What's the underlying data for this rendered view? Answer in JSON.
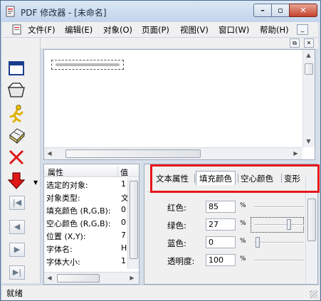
{
  "window": {
    "title": "PDF 修改器 - [未命名]",
    "minimize_label": "–",
    "maximize_label": "▫",
    "close_label": "✕"
  },
  "menu": {
    "items": [
      "文件(F)",
      "编辑(E)",
      "对象(O)",
      "页面(P)",
      "视图(V)",
      "窗口(W)",
      "帮助(H)"
    ],
    "mdi_minimize": "_",
    "mdi_restore": "⧉",
    "mdi_close": "✕"
  },
  "toolbar_icons": [
    "window-icon",
    "open-folder-icon",
    "run-icon",
    "printer-icon",
    "delete-x-icon",
    "down-arrow-icon"
  ],
  "nav_buttons": {
    "first": "|◀",
    "prev": "◀",
    "next": "▶",
    "last": "▶|"
  },
  "properties": {
    "header_name": "属性",
    "header_value": "值",
    "rows": [
      {
        "name": "选定的对象:",
        "value": "1"
      },
      {
        "name": "对象类型:",
        "value": "文"
      },
      {
        "name": "填充颜色 (R,G,B):",
        "value": "0"
      },
      {
        "name": "空心颜色 (R,G,B):",
        "value": "0"
      },
      {
        "name": "位置 (X,Y):",
        "value": "7"
      },
      {
        "name": "字体名:",
        "value": "H"
      },
      {
        "name": "字体大小:",
        "value": "1"
      }
    ]
  },
  "tabs": {
    "items": [
      "文本属性",
      "填充颜色",
      "空心颜色",
      "变形"
    ],
    "active_index": 1
  },
  "fill_color": {
    "red_label": "红色:",
    "red_value": "85",
    "green_label": "绿色:",
    "green_value": "27",
    "blue_label": "蓝色:",
    "blue_value": "0",
    "opacity_label": "透明度:",
    "opacity_value": "100",
    "percent": "%"
  },
  "status": {
    "text": "就绪"
  },
  "colors": {
    "highlight": "#e8161b",
    "titlebar": "#c2d4ec",
    "close_button": "#c4432d"
  }
}
